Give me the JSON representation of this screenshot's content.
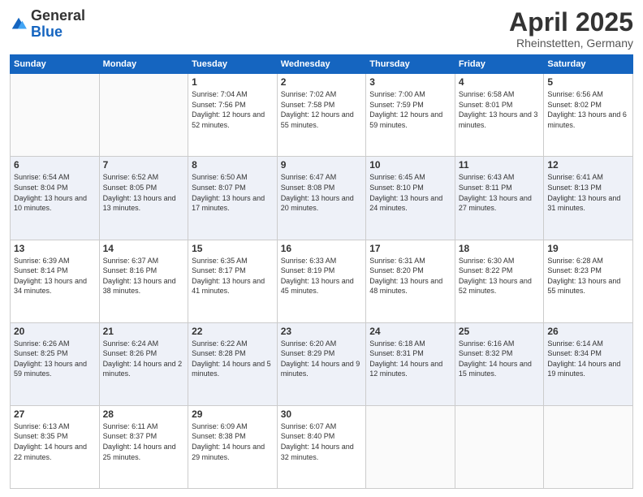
{
  "logo": {
    "general": "General",
    "blue": "Blue"
  },
  "header": {
    "month": "April 2025",
    "location": "Rheinstetten, Germany"
  },
  "days": [
    "Sunday",
    "Monday",
    "Tuesday",
    "Wednesday",
    "Thursday",
    "Friday",
    "Saturday"
  ],
  "weeks": [
    [
      {
        "num": "",
        "sunrise": "",
        "sunset": "",
        "daylight": "",
        "empty": true
      },
      {
        "num": "",
        "sunrise": "",
        "sunset": "",
        "daylight": "",
        "empty": true
      },
      {
        "num": "1",
        "sunrise": "Sunrise: 7:04 AM",
        "sunset": "Sunset: 7:56 PM",
        "daylight": "Daylight: 12 hours and 52 minutes."
      },
      {
        "num": "2",
        "sunrise": "Sunrise: 7:02 AM",
        "sunset": "Sunset: 7:58 PM",
        "daylight": "Daylight: 12 hours and 55 minutes."
      },
      {
        "num": "3",
        "sunrise": "Sunrise: 7:00 AM",
        "sunset": "Sunset: 7:59 PM",
        "daylight": "Daylight: 12 hours and 59 minutes."
      },
      {
        "num": "4",
        "sunrise": "Sunrise: 6:58 AM",
        "sunset": "Sunset: 8:01 PM",
        "daylight": "Daylight: 13 hours and 3 minutes."
      },
      {
        "num": "5",
        "sunrise": "Sunrise: 6:56 AM",
        "sunset": "Sunset: 8:02 PM",
        "daylight": "Daylight: 13 hours and 6 minutes."
      }
    ],
    [
      {
        "num": "6",
        "sunrise": "Sunrise: 6:54 AM",
        "sunset": "Sunset: 8:04 PM",
        "daylight": "Daylight: 13 hours and 10 minutes."
      },
      {
        "num": "7",
        "sunrise": "Sunrise: 6:52 AM",
        "sunset": "Sunset: 8:05 PM",
        "daylight": "Daylight: 13 hours and 13 minutes."
      },
      {
        "num": "8",
        "sunrise": "Sunrise: 6:50 AM",
        "sunset": "Sunset: 8:07 PM",
        "daylight": "Daylight: 13 hours and 17 minutes."
      },
      {
        "num": "9",
        "sunrise": "Sunrise: 6:47 AM",
        "sunset": "Sunset: 8:08 PM",
        "daylight": "Daylight: 13 hours and 20 minutes."
      },
      {
        "num": "10",
        "sunrise": "Sunrise: 6:45 AM",
        "sunset": "Sunset: 8:10 PM",
        "daylight": "Daylight: 13 hours and 24 minutes."
      },
      {
        "num": "11",
        "sunrise": "Sunrise: 6:43 AM",
        "sunset": "Sunset: 8:11 PM",
        "daylight": "Daylight: 13 hours and 27 minutes."
      },
      {
        "num": "12",
        "sunrise": "Sunrise: 6:41 AM",
        "sunset": "Sunset: 8:13 PM",
        "daylight": "Daylight: 13 hours and 31 minutes."
      }
    ],
    [
      {
        "num": "13",
        "sunrise": "Sunrise: 6:39 AM",
        "sunset": "Sunset: 8:14 PM",
        "daylight": "Daylight: 13 hours and 34 minutes."
      },
      {
        "num": "14",
        "sunrise": "Sunrise: 6:37 AM",
        "sunset": "Sunset: 8:16 PM",
        "daylight": "Daylight: 13 hours and 38 minutes."
      },
      {
        "num": "15",
        "sunrise": "Sunrise: 6:35 AM",
        "sunset": "Sunset: 8:17 PM",
        "daylight": "Daylight: 13 hours and 41 minutes."
      },
      {
        "num": "16",
        "sunrise": "Sunrise: 6:33 AM",
        "sunset": "Sunset: 8:19 PM",
        "daylight": "Daylight: 13 hours and 45 minutes."
      },
      {
        "num": "17",
        "sunrise": "Sunrise: 6:31 AM",
        "sunset": "Sunset: 8:20 PM",
        "daylight": "Daylight: 13 hours and 48 minutes."
      },
      {
        "num": "18",
        "sunrise": "Sunrise: 6:30 AM",
        "sunset": "Sunset: 8:22 PM",
        "daylight": "Daylight: 13 hours and 52 minutes."
      },
      {
        "num": "19",
        "sunrise": "Sunrise: 6:28 AM",
        "sunset": "Sunset: 8:23 PM",
        "daylight": "Daylight: 13 hours and 55 minutes."
      }
    ],
    [
      {
        "num": "20",
        "sunrise": "Sunrise: 6:26 AM",
        "sunset": "Sunset: 8:25 PM",
        "daylight": "Daylight: 13 hours and 59 minutes."
      },
      {
        "num": "21",
        "sunrise": "Sunrise: 6:24 AM",
        "sunset": "Sunset: 8:26 PM",
        "daylight": "Daylight: 14 hours and 2 minutes."
      },
      {
        "num": "22",
        "sunrise": "Sunrise: 6:22 AM",
        "sunset": "Sunset: 8:28 PM",
        "daylight": "Daylight: 14 hours and 5 minutes."
      },
      {
        "num": "23",
        "sunrise": "Sunrise: 6:20 AM",
        "sunset": "Sunset: 8:29 PM",
        "daylight": "Daylight: 14 hours and 9 minutes."
      },
      {
        "num": "24",
        "sunrise": "Sunrise: 6:18 AM",
        "sunset": "Sunset: 8:31 PM",
        "daylight": "Daylight: 14 hours and 12 minutes."
      },
      {
        "num": "25",
        "sunrise": "Sunrise: 6:16 AM",
        "sunset": "Sunset: 8:32 PM",
        "daylight": "Daylight: 14 hours and 15 minutes."
      },
      {
        "num": "26",
        "sunrise": "Sunrise: 6:14 AM",
        "sunset": "Sunset: 8:34 PM",
        "daylight": "Daylight: 14 hours and 19 minutes."
      }
    ],
    [
      {
        "num": "27",
        "sunrise": "Sunrise: 6:13 AM",
        "sunset": "Sunset: 8:35 PM",
        "daylight": "Daylight: 14 hours and 22 minutes."
      },
      {
        "num": "28",
        "sunrise": "Sunrise: 6:11 AM",
        "sunset": "Sunset: 8:37 PM",
        "daylight": "Daylight: 14 hours and 25 minutes."
      },
      {
        "num": "29",
        "sunrise": "Sunrise: 6:09 AM",
        "sunset": "Sunset: 8:38 PM",
        "daylight": "Daylight: 14 hours and 29 minutes."
      },
      {
        "num": "30",
        "sunrise": "Sunrise: 6:07 AM",
        "sunset": "Sunset: 8:40 PM",
        "daylight": "Daylight: 14 hours and 32 minutes."
      },
      {
        "num": "",
        "sunrise": "",
        "sunset": "",
        "daylight": "",
        "empty": true
      },
      {
        "num": "",
        "sunrise": "",
        "sunset": "",
        "daylight": "",
        "empty": true
      },
      {
        "num": "",
        "sunrise": "",
        "sunset": "",
        "daylight": "",
        "empty": true
      }
    ]
  ]
}
